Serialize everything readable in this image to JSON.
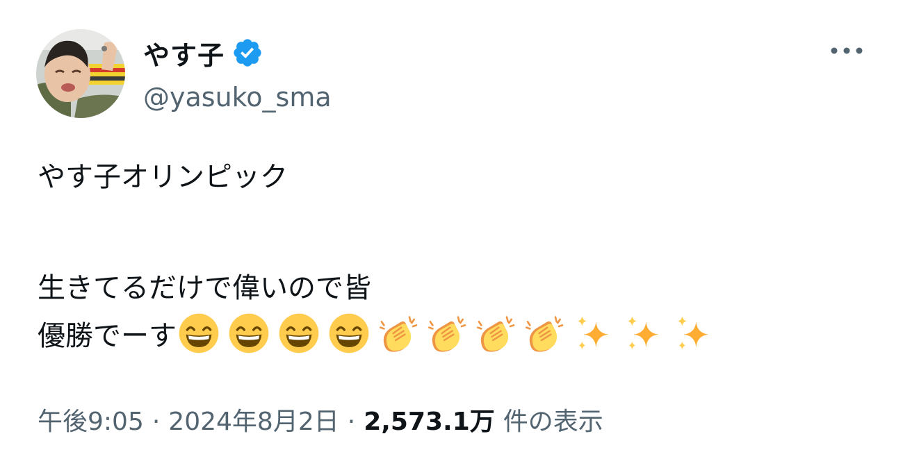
{
  "user": {
    "display_name": "やす子",
    "handle": "@yasuko_sma",
    "verified_color": "#1d9bf0"
  },
  "tweet": {
    "line1": "やす子オリンピック",
    "line2": "生きてるだけで偉いので皆",
    "line3": "優勝でーす",
    "emojis": [
      "grinning-face",
      "grinning-face",
      "grinning-face",
      "grinning-face",
      "clapping-hands",
      "clapping-hands",
      "clapping-hands",
      "clapping-hands",
      "sparkles",
      "sparkles",
      "sparkles"
    ]
  },
  "meta": {
    "time": "午後9:05",
    "separator": "·",
    "date": "2024年8月2日",
    "views_count": "2,573.1万",
    "views_label": "件の表示"
  },
  "icons": {
    "more": "more-horizontal-icon",
    "verified": "verified-badge-icon"
  }
}
